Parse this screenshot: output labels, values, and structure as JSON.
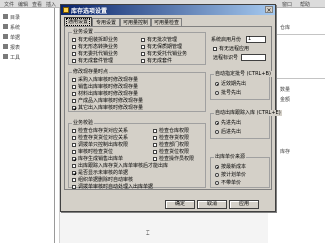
{
  "background": {
    "menu_items": [
      "文件",
      "编辑",
      "查看",
      "插入",
      "窗口",
      "帮助"
    ],
    "side_labels": [
      "目录",
      "系统",
      "单据",
      "报表",
      "工具"
    ],
    "right_labels": [
      "仓库",
      "数量",
      "金额",
      "库存"
    ]
  },
  "dialog": {
    "title": "库存选项设置",
    "close_label": "×",
    "tabs": [
      {
        "label": "通用设置",
        "active": true
      },
      {
        "label": "专用设置",
        "active": false
      },
      {
        "label": "可用量控制",
        "active": false
      },
      {
        "label": "可用量检查",
        "active": false
      }
    ],
    "business_settings": {
      "title": "业务设置",
      "col1": [
        {
          "label": "有无组装拆卸业务",
          "checked": false
        },
        {
          "label": "有无形态转换业务",
          "checked": false
        },
        {
          "label": "有无委托代销业务",
          "checked": false
        },
        {
          "label": "有无成套件管理",
          "checked": false
        }
      ],
      "col2": [
        {
          "label": "有无批次管理",
          "checked": false
        },
        {
          "label": "有无保质期管理",
          "checked": false
        },
        {
          "label": "有无受托代销业务",
          "checked": false
        },
        {
          "label": "有无成套件",
          "checked": false
        }
      ],
      "col3": [
        {
          "label": "有无批次管理",
          "checked": false
        },
        {
          "label": "有无保质期管理",
          "checked": false
        },
        {
          "label": "有无成套件管理",
          "checked": false
        }
      ]
    },
    "system_start": {
      "label": "系统启用月份",
      "value": "1",
      "has_stop_label": "有无远程应用",
      "has_stop_checked": false,
      "remote_label": "远程标识号",
      "remote_value": ""
    },
    "modify_range": {
      "title": "修改现存量时点",
      "items": [
        {
          "label": "采购入库审核时修改现存量",
          "checked": false
        },
        {
          "label": "销售出库审核时修改现存量",
          "checked": false
        },
        {
          "label": "材料出库审核时修改现存量",
          "checked": false
        },
        {
          "label": "产成品入库审核时修改现存量",
          "checked": false
        },
        {
          "label": "其它出入库审核时修改现存量",
          "checked": true
        }
      ]
    },
    "auto_assign": {
      "title": "自动指定批号 (CTRL+B)",
      "options": [
        {
          "label": "近效期先出",
          "selected": true
        },
        {
          "label": "批号先出",
          "selected": false
        }
      ]
    },
    "auto_out_record": {
      "title": "自动出库跟踪入库 (CTRL+E)",
      "options": [
        {
          "label": "先进先出",
          "selected": true
        },
        {
          "label": "后进先出",
          "selected": false
        }
      ]
    },
    "verify_control": {
      "title": "业务校验",
      "col1": [
        {
          "label": "检查仓库存货对应关系",
          "checked": false
        },
        {
          "label": "检查存货货位对应关系",
          "checked": false
        },
        {
          "label": "调拨单只控制出库权限",
          "checked": false
        },
        {
          "label": "审核时检查货位",
          "checked": false
        },
        {
          "label": "库存生成销售出库单",
          "checked": true
        },
        {
          "label": "出库跟踪入库存货入库单审核后才能出库",
          "checked": false
        },
        {
          "label": "是否显示未审核的单据",
          "checked": true
        },
        {
          "label": "组织单据删除时自动审核",
          "checked": false
        },
        {
          "label": "调拨单审核时自动处理入出库单据",
          "checked": false
        }
      ],
      "col2": [
        {
          "label": "检查仓库权限",
          "checked": false
        },
        {
          "label": "检查存货权限",
          "checked": false
        },
        {
          "label": "检查部门权限",
          "checked": false
        },
        {
          "label": "检查货位权限",
          "checked": false
        },
        {
          "label": "检查操作员权限",
          "checked": false
        }
      ]
    },
    "out_cost": {
      "title": "出库单价来源",
      "options": [
        {
          "label": "按最新成本",
          "selected": true
        },
        {
          "label": "按计划单价",
          "selected": false
        },
        {
          "label": "不带单价",
          "selected": false
        }
      ]
    },
    "buttons": {
      "ok": "确定",
      "cancel": "取消",
      "apply": "应用",
      "help": "帮助"
    }
  }
}
